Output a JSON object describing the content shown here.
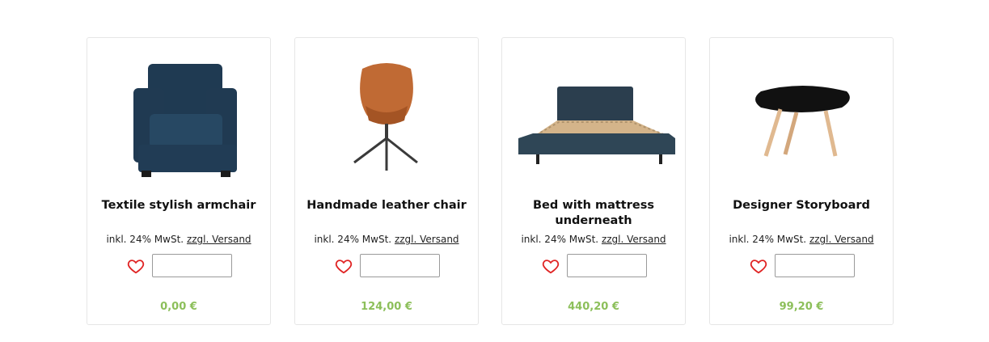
{
  "products": [
    {
      "title": "Textile stylish armchair",
      "tax_prefix": "inkl. 24% MwSt.",
      "shipping_link": "zzgl. Versand",
      "quantity_value": "",
      "price": "0,00 €"
    },
    {
      "title": "Handmade leather chair",
      "tax_prefix": "inkl. 24% MwSt.",
      "shipping_link": "zzgl. Versand",
      "quantity_value": "",
      "price": "124,00 €"
    },
    {
      "title": "Bed with mattress underneath",
      "tax_prefix": "inkl. 24% MwSt.",
      "shipping_link": "zzgl. Versand",
      "quantity_value": "",
      "price": "440,20 €"
    },
    {
      "title": "Designer Storyboard",
      "tax_prefix": "inkl. 24% MwSt.",
      "shipping_link": "zzgl. Versand",
      "quantity_value": "",
      "price": "99,20 €"
    }
  ],
  "colors": {
    "price": "#8cbf5a",
    "heart": "#e02424",
    "card_border": "#e6e6e6"
  },
  "icons": {
    "wishlist": "heart-outline-icon"
  }
}
